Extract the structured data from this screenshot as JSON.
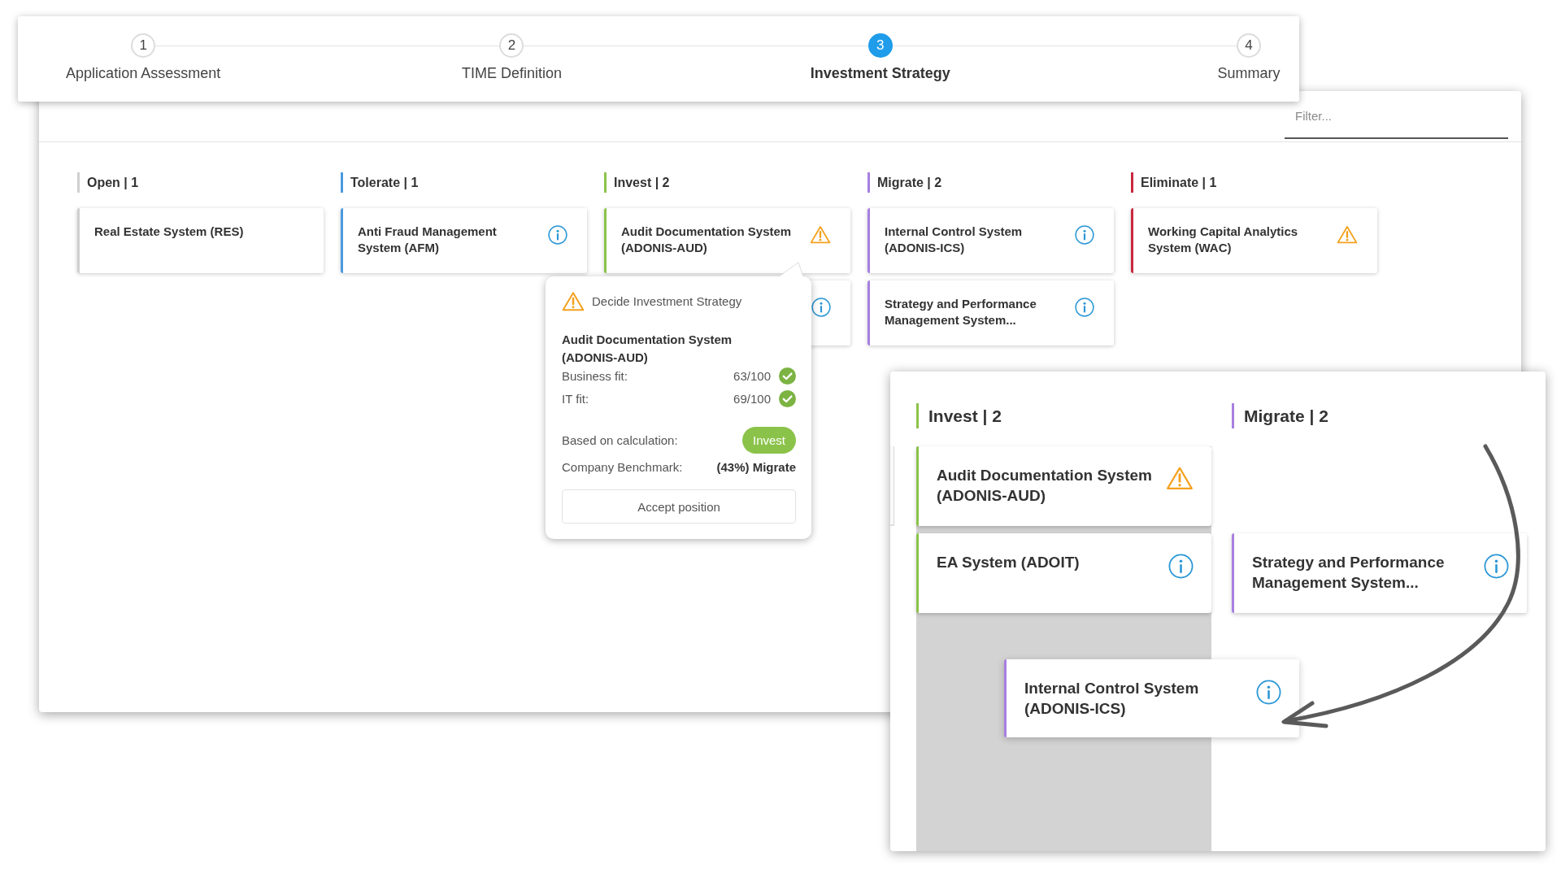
{
  "stepper": {
    "steps": [
      {
        "number": "1",
        "label": "Application Assessment",
        "selected": false
      },
      {
        "number": "2",
        "label": "TIME Definition",
        "selected": false
      },
      {
        "number": "3",
        "label": "Investment Strategy",
        "selected": true
      },
      {
        "number": "4",
        "label": "Summary",
        "selected": false
      }
    ]
  },
  "board": {
    "filter": {
      "placeholder": "Filter..."
    },
    "columns": [
      {
        "title": "Open | 1",
        "color": "#cfcfcf",
        "cards": [
          {
            "name": "Real Estate System (RES)",
            "kind": "plain"
          }
        ]
      },
      {
        "title": "Tolerate | 1",
        "color": "#4a9ae0",
        "cards": [
          {
            "name": "Anti Fraud Management System (AFM)",
            "kind": "info"
          }
        ]
      },
      {
        "title": "Invest | 2",
        "color": "#8bc34a",
        "cards": [
          {
            "name": "Audit Documentation System (ADONIS-AUD)",
            "kind": "warning"
          },
          {
            "kind": "info"
          }
        ]
      },
      {
        "title": "Migrate | 2",
        "color": "#a77fe0",
        "cards": [
          {
            "name": "Internal Control System (ADONIS-ICS)",
            "kind": "info"
          },
          {
            "name": "Strategy and Performance Management System...",
            "kind": "info"
          }
        ]
      },
      {
        "title": "Eliminate | 1",
        "color": "#c8283e",
        "cards": [
          {
            "name": "Working Capital Analytics System (WAC)",
            "kind": "warning"
          }
        ]
      }
    ]
  },
  "popover": {
    "heading": "Decide Investment Strategy",
    "application": "Audit Documentation System (ADONIS-AUD)",
    "fits": [
      {
        "label": "Business fit:",
        "score": "63/100",
        "passed": true
      },
      {
        "label": "IT fit:",
        "score": "69/100",
        "passed": true
      }
    ],
    "calculation": {
      "label": "Based on calculation:",
      "result": "Invest"
    },
    "benchmark": {
      "label": "Company Benchmark:",
      "value": "(43%) Migrate"
    },
    "action": "Accept position"
  },
  "inset": {
    "columns": [
      {
        "title": "Invest | 2",
        "color": "#8bc34a",
        "drop_target": true,
        "cards": [
          {
            "name": "Audit Documentation System (ADONIS-AUD)",
            "kind": "warning",
            "dragging": false
          },
          {
            "name": "EA System (ADOIT)",
            "kind": "info",
            "dragging": false
          }
        ]
      },
      {
        "title": "Migrate | 2",
        "color": "#a77fe0",
        "drop_target": false,
        "cards": [
          {
            "name": "Internal Control System (ADONIS-ICS)",
            "kind": "info",
            "dragging": true
          },
          {
            "name": "Strategy and Performance Management System...",
            "kind": "info",
            "dragging": false
          }
        ]
      }
    ]
  }
}
